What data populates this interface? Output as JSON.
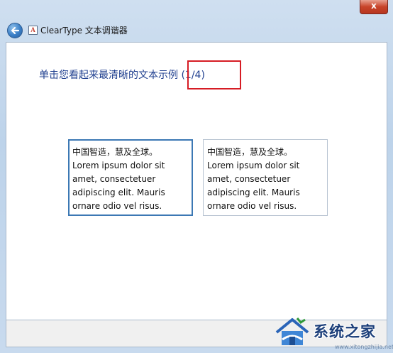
{
  "window": {
    "title": "ClearType 文本调谐器",
    "close_label": "x",
    "app_icon_glyph": "A"
  },
  "main": {
    "heading": "单击您看起来最清晰的文本示例 (1/4)",
    "samples": [
      {
        "lines": [
          "中国智造，慧及全球。",
          "Lorem ipsum dolor sit",
          "amet, consectetuer",
          "adipiscing elit. Mauris",
          "ornare odio vel risus."
        ],
        "selected": true
      },
      {
        "lines": [
          "中国智造，慧及全球。",
          "Lorem ipsum dolor sit",
          "amet, consectetuer",
          "adipiscing elit. Mauris",
          "ornare odio vel risus."
        ],
        "selected": false
      }
    ]
  },
  "watermark": {
    "text": "系统之家",
    "subtext": "www.xitongzhijia.net"
  },
  "colors": {
    "heading": "#1f3f8f",
    "highlight_box": "#d61c24",
    "selected_border": "#3c78b4"
  }
}
